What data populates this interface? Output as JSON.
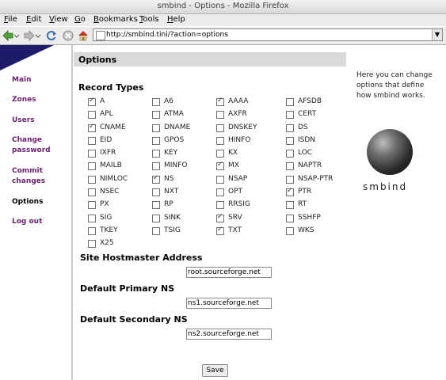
{
  "window": {
    "title": "smbind - Options - Mozilla Firefox"
  },
  "menubar": [
    {
      "pre": "",
      "key": "F",
      "post": "ile"
    },
    {
      "pre": "",
      "key": "E",
      "post": "dit"
    },
    {
      "pre": "",
      "key": "V",
      "post": "iew"
    },
    {
      "pre": "",
      "key": "G",
      "post": "o"
    },
    {
      "pre": "",
      "key": "B",
      "post": "ookmarks"
    },
    {
      "pre": "",
      "key": "T",
      "post": "ools"
    },
    {
      "pre": "",
      "key": "H",
      "post": "elp"
    }
  ],
  "navbar": {
    "url": "http://smbind.tini/?action=options",
    "icons": [
      "back-icon",
      "forward-icon",
      "reload-icon",
      "stop-icon",
      "home-icon"
    ]
  },
  "sidebar": {
    "items": [
      {
        "lines": [
          "Main"
        ],
        "active": false
      },
      {
        "lines": [
          "Zones"
        ],
        "active": false
      },
      {
        "lines": [
          "Users"
        ],
        "active": false
      },
      {
        "lines": [
          "Change",
          "password"
        ],
        "active": false
      },
      {
        "lines": [
          "Commit",
          "changes"
        ],
        "active": false
      },
      {
        "lines": [
          "Options"
        ],
        "active": true
      },
      {
        "lines": [
          "Log out"
        ],
        "active": false
      }
    ]
  },
  "main": {
    "section_title": "Options",
    "record_types_title": "Record Types",
    "record_types": [
      {
        "label": "A",
        "checked": true
      },
      {
        "label": "A6",
        "checked": false
      },
      {
        "label": "AAAA",
        "checked": true
      },
      {
        "label": "AFSDB",
        "checked": false
      },
      {
        "label": "APL",
        "checked": false
      },
      {
        "label": "ATMA",
        "checked": false
      },
      {
        "label": "AXFR",
        "checked": false
      },
      {
        "label": "CERT",
        "checked": false
      },
      {
        "label": "CNAME",
        "checked": true
      },
      {
        "label": "DNAME",
        "checked": false
      },
      {
        "label": "DNSKEY",
        "checked": false
      },
      {
        "label": "DS",
        "checked": false
      },
      {
        "label": "EID",
        "checked": false
      },
      {
        "label": "GPOS",
        "checked": false
      },
      {
        "label": "HINFO",
        "checked": false
      },
      {
        "label": "ISDN",
        "checked": false
      },
      {
        "label": "IXFR",
        "checked": false
      },
      {
        "label": "KEY",
        "checked": false
      },
      {
        "label": "KX",
        "checked": false
      },
      {
        "label": "LOC",
        "checked": false
      },
      {
        "label": "MAILB",
        "checked": false
      },
      {
        "label": "MINFO",
        "checked": false
      },
      {
        "label": "MX",
        "checked": true
      },
      {
        "label": "NAPTR",
        "checked": false
      },
      {
        "label": "NIMLOC",
        "checked": false
      },
      {
        "label": "NS",
        "checked": true
      },
      {
        "label": "NSAP",
        "checked": false
      },
      {
        "label": "NSAP-PTR",
        "checked": false
      },
      {
        "label": "NSEC",
        "checked": false
      },
      {
        "label": "NXT",
        "checked": false
      },
      {
        "label": "OPT",
        "checked": false
      },
      {
        "label": "PTR",
        "checked": true
      },
      {
        "label": "PX",
        "checked": false
      },
      {
        "label": "RP",
        "checked": false
      },
      {
        "label": "RRSIG",
        "checked": false
      },
      {
        "label": "RT",
        "checked": false
      },
      {
        "label": "SIG",
        "checked": false
      },
      {
        "label": "SINK",
        "checked": false
      },
      {
        "label": "SRV",
        "checked": true
      },
      {
        "label": "SSHFP",
        "checked": false
      },
      {
        "label": "TKEY",
        "checked": false
      },
      {
        "label": "TSIG",
        "checked": false
      },
      {
        "label": "TXT",
        "checked": true
      },
      {
        "label": "WKS",
        "checked": false
      },
      {
        "label": "X25",
        "checked": false
      }
    ],
    "hostmaster": {
      "label": "Site Hostmaster Address",
      "value": "root.sourceforge.net"
    },
    "primary_ns": {
      "label": "Default Primary NS",
      "value": "ns1.sourceforge.net"
    },
    "secondary_ns": {
      "label": "Default Secondary NS",
      "value": "ns2.sourceforge.net"
    },
    "save_label": "Save"
  },
  "help": {
    "text": "Here you can change options that define how smbind works.",
    "brand": "smbind"
  },
  "colors": {
    "sidebar_link": "#6b1f6e",
    "sidebar_header": "#1c1c6b",
    "options_bar": "#d9d9d9"
  }
}
